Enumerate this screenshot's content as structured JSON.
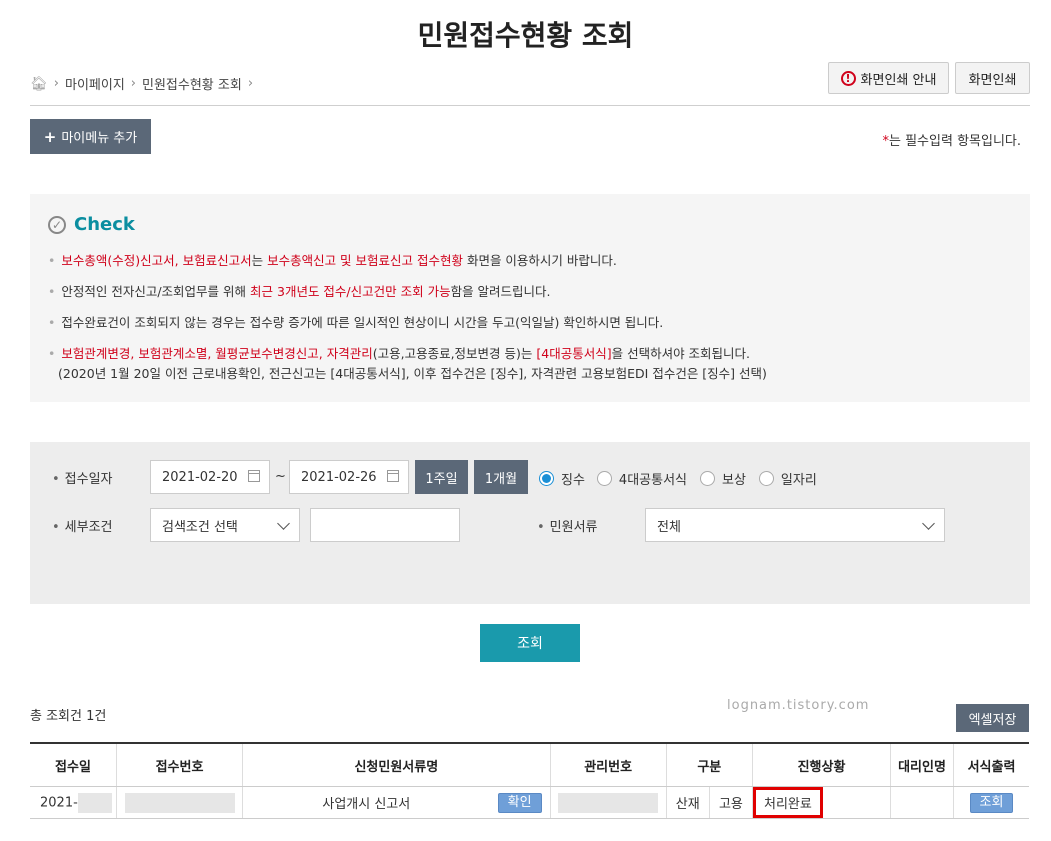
{
  "page": {
    "title": "민원접수현황 조회"
  },
  "breadcrumb": {
    "items": [
      "마이페이지",
      "민원접수현황 조회"
    ]
  },
  "top_buttons": {
    "print_guide": "화면인쇄 안내",
    "print": "화면인쇄"
  },
  "mymenu": {
    "label": "마이메뉴 추가"
  },
  "required_note": {
    "star": "*",
    "text": "는 필수입력 항목입니다."
  },
  "check": {
    "title": "Check",
    "line1": {
      "r1": "보수총액(수정)신고서, 보험료신고서",
      "t1": "는 ",
      "r2": "보수총액신고 및 보험료신고 접수현황",
      "t2": " 화면을 이용하시기 바랍니다."
    },
    "line2": {
      "t1": "안정적인 전자신고/조회업무를 위해 ",
      "r1": "최근 3개년도 접수/신고건만 조회 가능",
      "t2": "함을 알려드립니다."
    },
    "line3": {
      "t1": "접수완료건이 조회되지 않는 경우는 접수량 증가에 따른 일시적인 현상이니 시간을 두고(익일날) 확인하시면 됩니다."
    },
    "line4": {
      "r1": "보험관계변경, 보험관계소멸, 월평균보수변경신고, 자격관리",
      "t1": "(고용,고용종료,정보변경 등)는 ",
      "r2": "[4대공통서식]",
      "t2": "을 선택하셔야 조회됩니다."
    },
    "line5": {
      "t1": "(2020년 1월 20일 이전 근로내용확인, 전근신고는 [4대공통서식], 이후 접수건은 [징수], 자격관련 고용보험EDI 접수건은 [징수] 선택)"
    }
  },
  "search": {
    "date_label": "접수일자",
    "date_from": "2021-02-20",
    "tilde": "~",
    "date_to": "2021-02-26",
    "week_btn": "1주일",
    "month_btn": "1개월",
    "radios": [
      {
        "label": "징수",
        "selected": true
      },
      {
        "label": "4대공통서식",
        "selected": false
      },
      {
        "label": "보상",
        "selected": false
      },
      {
        "label": "일자리",
        "selected": false
      }
    ],
    "detail_label": "세부조건",
    "detail_select": "검색조건 선택",
    "detail_input": "",
    "doc_label": "민원서류",
    "doc_select": "전체"
  },
  "query_button": "조회",
  "results": {
    "total": "총 조회건 1건",
    "watermark": "lognam.tistory.com",
    "excel_button": "엑셀저장",
    "headers": [
      "접수일",
      "접수번호",
      "신청민원서류명",
      "관리번호",
      "구분",
      "진행상황",
      "대리인명",
      "서식출력"
    ],
    "rows": [
      {
        "date": "2021-",
        "receipt_no": "",
        "doc_name": "사업개시 신고서",
        "confirm": "확인",
        "manage_no": "",
        "type1": "산재",
        "type2": "고용",
        "status": "처리완료",
        "agent": "",
        "print": "조회"
      }
    ]
  },
  "colors": {
    "accent": "#1a9aac",
    "button_dark": "#5b6878",
    "highlight_red": "#d0021b",
    "link_blue": "#6f9fd8"
  }
}
